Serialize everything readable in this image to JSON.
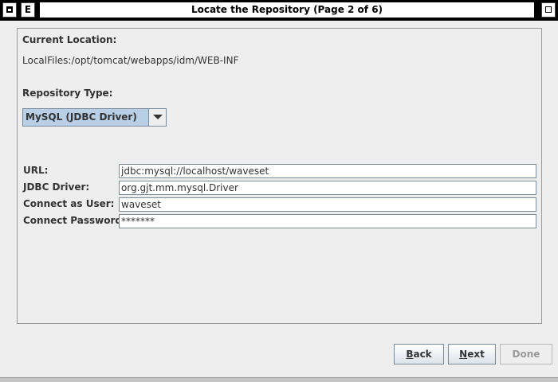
{
  "window": {
    "title": "Locate the Repository (Page 2 of 6)",
    "menu_button_icon": "window-menu-icon",
    "e_button_label": "E",
    "maximize_icon": "maximize-icon"
  },
  "current_location": {
    "label": "Current Location:",
    "value": "LocalFiles:/opt/tomcat/webapps/idm/WEB-INF"
  },
  "repository_type": {
    "label": "Repository Type:",
    "selected": "MySQL  (JDBC Driver)"
  },
  "fields": {
    "url": {
      "label": "URL:",
      "value": "jdbc:mysql://localhost/waveset"
    },
    "jdbc_driver": {
      "label": "JDBC Driver:",
      "value": "org.gjt.mm.mysql.Driver"
    },
    "user": {
      "label": "Connect as User:",
      "value": "waveset"
    },
    "password": {
      "label": "Connect Password:",
      "value": "*******"
    }
  },
  "buttons": {
    "back": {
      "mnemonic": "B",
      "rest": "ack"
    },
    "next": {
      "mnemonic": "N",
      "rest": "ext"
    },
    "done": {
      "label": "Done",
      "enabled": false
    }
  },
  "colors": {
    "title_bar": "#000000",
    "combo_selected": "#b8cfe5",
    "background": "#eeeeee"
  }
}
